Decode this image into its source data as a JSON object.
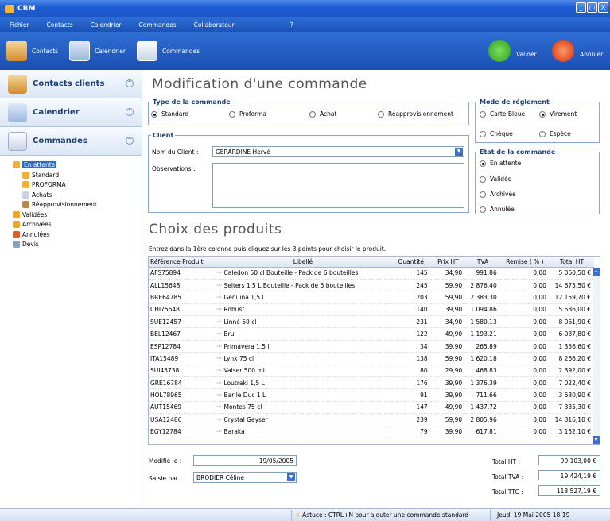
{
  "window": {
    "title": "CRM",
    "min": "_",
    "max": "□",
    "close": "X"
  },
  "menu": [
    "Fichier",
    "Contacts",
    "Calendrier",
    "Commandes",
    "Collaborateur",
    "?"
  ],
  "toolbar": {
    "contacts": "Contacts",
    "calendrier": "Calendrier",
    "commandes": "Commandes",
    "valider": "Valider",
    "annuler": "Annuler"
  },
  "sidebar": {
    "sections": [
      "Contacts clients",
      "Calendrier",
      "Commandes"
    ],
    "tree": [
      {
        "label": "En attente",
        "selected": true,
        "indent": 0
      },
      {
        "label": "Standard",
        "indent": 1
      },
      {
        "label": "PROFORMA",
        "indent": 1
      },
      {
        "label": "Achats",
        "indent": 1
      },
      {
        "label": "Réapprovisionnement",
        "indent": 1
      },
      {
        "label": "Validées",
        "indent": 0
      },
      {
        "label": "Archivées",
        "indent": 0
      },
      {
        "label": "Annulées",
        "indent": 0
      },
      {
        "label": "Devis",
        "indent": 0
      }
    ]
  },
  "form": {
    "title": "Modification d'une commande",
    "type_legend": "Type de la commande",
    "types": [
      "Standard",
      "Proforma",
      "Achat",
      "Réapprovisionnement"
    ],
    "type_selected": "Standard",
    "mode_legend": "Mode de réglement",
    "modes": [
      "Carte Bleue",
      "Virement",
      "Chèque",
      "Espèce"
    ],
    "mode_selected": "Virement",
    "client_legend": "Client",
    "client_label": "Nom du Client :",
    "client_value": "GERARDINE Hervé",
    "obs_label": "Observations :",
    "etat_legend": "Etat de la commande",
    "etats": [
      "En attente",
      "Validée",
      "Archivée",
      "Annulée"
    ],
    "etat_selected": "En attente"
  },
  "products": {
    "title": "Choix des produits",
    "hint": "Entrez dans la 1ère colonne puis cliquez sur les 3 points pour choisir le produit.",
    "columns": [
      "Référence Produit",
      "Libellé",
      "Quantité",
      "Prix HT",
      "TVA",
      "Remise ( % )",
      "Total HT"
    ],
    "rows": [
      [
        "AFS75894",
        "Caledon 50 cl Bouteille - Pack de 6 bouteilles",
        "145",
        "34,90",
        "991,86",
        "0,00",
        "5 060,50 €"
      ],
      [
        "ALL15648",
        "Selters 1.5 L Bouteille - Pack de 6 bouteilles",
        "245",
        "59,90",
        "2 876,40",
        "0,00",
        "14 675,50 €"
      ],
      [
        "BRE64785",
        "Genuina 1,5 l",
        "203",
        "59,90",
        "2 383,30",
        "0,00",
        "12 159,70 €"
      ],
      [
        "CHI75648",
        "Robust",
        "140",
        "39,90",
        "1 094,86",
        "0,00",
        "5 586,00 €"
      ],
      [
        "SUE12457",
        "Linné 50 cl",
        "231",
        "34,90",
        "1 580,13",
        "0,00",
        "8 061,90 €"
      ],
      [
        "BEL12467",
        "Bru",
        "122",
        "49,90",
        "1 193,21",
        "0,00",
        "6 087,80 €"
      ],
      [
        "ESP12784",
        "Primavera 1,5 l",
        "34",
        "39,90",
        "265,89",
        "0,00",
        "1 356,60 €"
      ],
      [
        "ITA15489",
        "Lynx 75 cl",
        "138",
        "59,90",
        "1 620,18",
        "0,00",
        "8 266,20 €"
      ],
      [
        "SUI45738",
        "Valser 500 ml",
        "80",
        "29,90",
        "468,83",
        "0,00",
        "2 392,00 €"
      ],
      [
        "GRE16784",
        "Loutraki 1,5 L",
        "176",
        "39,90",
        "1 376,39",
        "0,00",
        "7 022,40 €"
      ],
      [
        "HOL78965",
        "Bar le Duc 1 L",
        "91",
        "39,90",
        "711,66",
        "0,00",
        "3 630,90 €"
      ],
      [
        "AUT15469",
        "Montes 75 cl",
        "147",
        "49,90",
        "1 437,72",
        "0,00",
        "7 335,30 €"
      ],
      [
        "USA12486",
        "Crystal Geyser",
        "239",
        "59,90",
        "2 805,96",
        "0,00",
        "14 316,10 €"
      ],
      [
        "EGY12784",
        "Baraka",
        "79",
        "39,90",
        "617,81",
        "0,00",
        "3 152,10 €"
      ]
    ]
  },
  "footer": {
    "modified_label": "Modifié le :",
    "modified_value": "19/05/2005",
    "saisie_label": "Saisie par :",
    "saisie_value": "BRODIER Céline",
    "total_ht_label": "Total HT :",
    "total_ht": "99 103,00 €",
    "total_tva_label": "Total TVA :",
    "total_tva": "19 424,19 €",
    "total_ttc_label": "Total TTC :",
    "total_ttc": "118 527,19 €"
  },
  "status": {
    "tip": "Astuce : CTRL+N pour ajouter une commande standard",
    "date": "Jeudi 19 Mai 2005 18:19"
  }
}
